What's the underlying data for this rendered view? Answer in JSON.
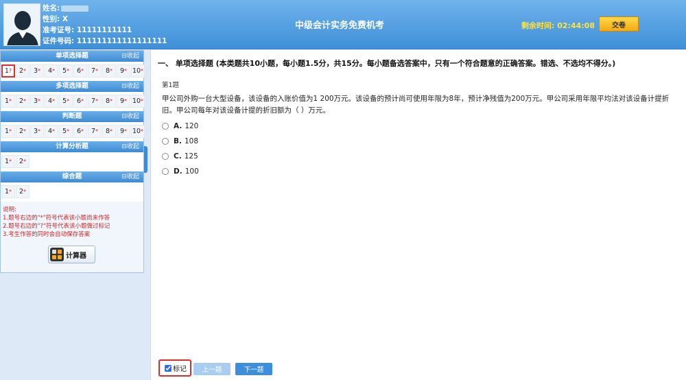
{
  "candidate": {
    "name_label": "姓名:",
    "gender_label": "性别:",
    "gender_value": "X",
    "admission_label": "准考证号:",
    "admission_value": "11111111111",
    "id_label": "证件号码:",
    "id_value": "111111111111111111"
  },
  "header": {
    "title": "中级会计实务免费机考",
    "timer_label": "剩余时间:",
    "timer_value": "02:44:08",
    "submit_label": "交卷"
  },
  "sidebar": {
    "collapse_label": "收起",
    "sections": [
      {
        "title": "单项选择题",
        "items": [
          "1",
          "2",
          "3",
          "4",
          "5",
          "6",
          "7",
          "8",
          "9",
          "10"
        ]
      },
      {
        "title": "多项选择题",
        "items": [
          "1",
          "2",
          "3",
          "4",
          "5",
          "6",
          "7",
          "8",
          "9",
          "10"
        ]
      },
      {
        "title": "判断题",
        "items": [
          "1",
          "2",
          "3",
          "4",
          "5",
          "6",
          "7",
          "8",
          "9",
          "10"
        ]
      },
      {
        "title": "计算分析题",
        "items": [
          "1",
          "2"
        ]
      },
      {
        "title": "综合题",
        "items": [
          "1",
          "2"
        ]
      }
    ],
    "current_marker": "?",
    "unanswered_marker": "*",
    "notes": {
      "title": "说明:",
      "line1": "1.题号右边的\"*\"符号代表该小题尚未作答",
      "line2": "2.题号右边的\"?\"符号代表该小题做过标记",
      "line3": "3.考生作答的同时会自动保存答案"
    },
    "calculator_label": "计算器"
  },
  "question": {
    "section_desc": "一、 单项选择题 (本类题共10小题，每小题1.5分，共15分。每小题备选答案中，只有一个符合题意的正确答案。错选、不选均不得分。)",
    "index_label": "第1题",
    "stem": "甲公司外购一台大型设备，该设备的入账价值为1 200万元。该设备的预计尚可使用年限为8年，预计净残值为200万元。甲公司采用年限平均法对该设备计提折旧。甲公司每年对该设备计提的折旧额为（    ）万元。",
    "options": [
      {
        "letter": "A.",
        "text": "120"
      },
      {
        "letter": "B.",
        "text": "108"
      },
      {
        "letter": "C.",
        "text": "125"
      },
      {
        "letter": "D.",
        "text": "100"
      }
    ]
  },
  "footer": {
    "mark_label": "标记",
    "prev_label": "上一题",
    "next_label": "下一题"
  },
  "colors": {
    "header_blue": "#3f8fd8",
    "timer_yellow": "#ffe33a",
    "highlight_red": "#e02b2b"
  }
}
